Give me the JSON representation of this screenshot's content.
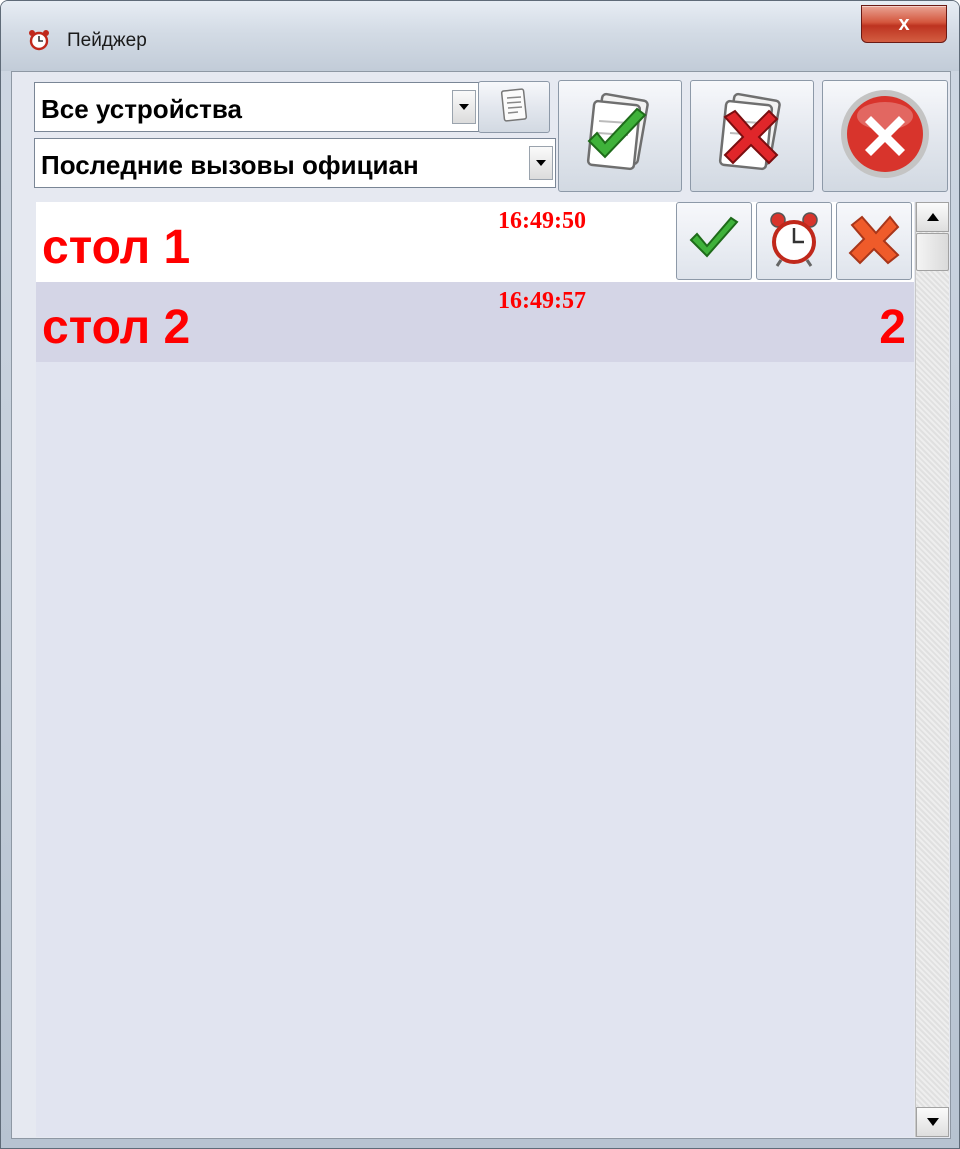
{
  "window": {
    "title": "Пейджер",
    "close_label": "x"
  },
  "toolbar": {
    "device_select": {
      "value": "Все устройства"
    },
    "filter_select": {
      "value": "Последние вызовы официан"
    },
    "buttons": [
      {
        "icon": "notes-icon"
      },
      {
        "icon": "accept-all-icon"
      },
      {
        "icon": "reject-all-icon"
      },
      {
        "icon": "close-circle-icon"
      }
    ]
  },
  "calls": [
    {
      "title": "стол 1",
      "time": "16:49:50",
      "count": "",
      "selected": true,
      "actions": [
        "check-icon",
        "alarm-clock-icon",
        "cross-icon"
      ]
    },
    {
      "title": "стол 2",
      "time": "16:49:57",
      "count": "2",
      "selected": false
    }
  ],
  "colors": {
    "call_text": "#ff0000",
    "selected_row": "#ffffff",
    "second_row": "#d4d5e6",
    "list_bg": "#e1e4f0"
  }
}
